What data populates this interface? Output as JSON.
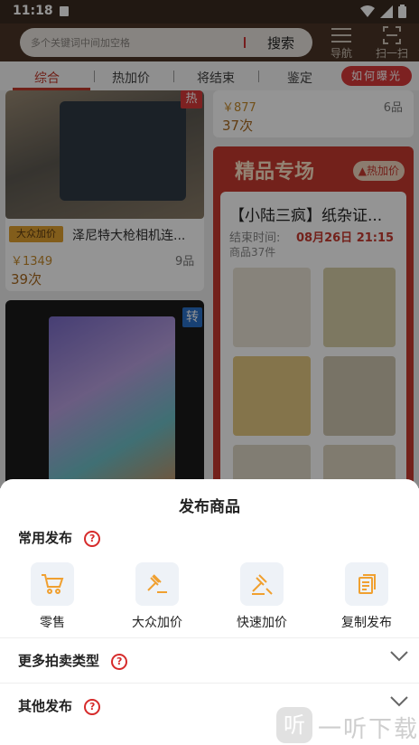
{
  "status_bar": {
    "time": "11:18"
  },
  "header": {
    "search_placeholder": "多个关键词中间加空格",
    "search_button": "搜索",
    "nav_label": "导航",
    "scan_label": "扫一扫"
  },
  "tabs": {
    "items": [
      "综合",
      "热加价",
      "将结束",
      "鉴定"
    ],
    "active": "综合",
    "how_button": "如何曝光"
  },
  "feed": {
    "top_right": {
      "price": "￥877",
      "bids": "37次",
      "count": "6品"
    },
    "camera_card": {
      "badge": "热",
      "tag": "大众加价",
      "title": "泽尼特大枪相机连...",
      "price": "￥1349",
      "count": "9品",
      "bids": "39次"
    },
    "special": {
      "header": "精品专场",
      "hot_badge": "热加价",
      "session_title": "【小陆三疯】纸杂证...",
      "end_label": "结束时间:",
      "end_time": "08月26日 21:15",
      "item_count": "商品37件"
    },
    "card_two": {
      "badge": "转"
    }
  },
  "sheet": {
    "title": "发布商品",
    "common_section": "常用发布",
    "options": [
      {
        "label": "零售",
        "icon": "cart-icon"
      },
      {
        "label": "大众加价",
        "icon": "gavel-icon"
      },
      {
        "label": "快速加价",
        "icon": "gavel-fast-icon"
      },
      {
        "label": "复制发布",
        "icon": "copy-icon"
      }
    ],
    "more_types": "更多拍卖类型",
    "other_publish": "其他发布",
    "help_mark": "?"
  },
  "watermark": {
    "text": "一听下载",
    "logo": "听"
  },
  "colors": {
    "accent": "#d62b2b",
    "price": "#c58a2c",
    "icon_orange": "#f0a030",
    "header_bg": "#4a3526"
  }
}
